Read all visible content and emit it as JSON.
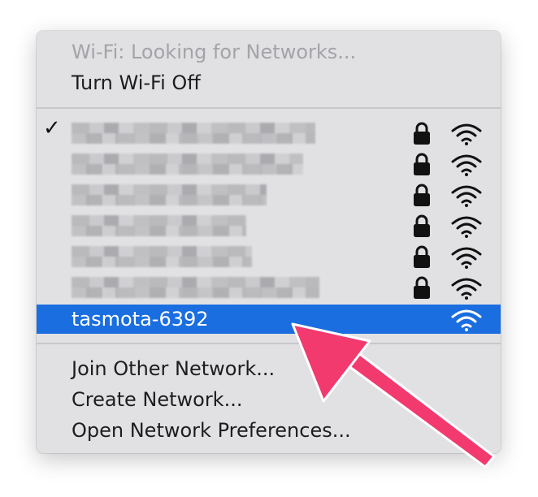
{
  "menu": {
    "status": "Wi-Fi: Looking for Networks...",
    "turn_off": "Turn Wi-Fi Off",
    "networks": [
      {
        "name": "",
        "connected": true,
        "secured": true,
        "icon": "wifi-icon"
      },
      {
        "name": "",
        "connected": false,
        "secured": true,
        "icon": "wifi-icon"
      },
      {
        "name": "",
        "connected": false,
        "secured": true,
        "icon": "wifi-icon"
      },
      {
        "name": "",
        "connected": false,
        "secured": true,
        "icon": "wifi-icon"
      },
      {
        "name": "",
        "connected": false,
        "secured": true,
        "icon": "wifi-icon"
      },
      {
        "name": "",
        "connected": false,
        "secured": true,
        "icon": "wifi-icon"
      }
    ],
    "check_mark": "✓",
    "selected_network": "tasmota-6392",
    "join_other": "Join Other Network...",
    "create_network": "Create Network...",
    "open_prefs": "Open Network Preferences..."
  },
  "colors": {
    "menu_bg": "#e1e1e3",
    "highlight": "#1a6ee0",
    "arrow": "#f23a6f",
    "disabled_text": "#a3a3a8"
  },
  "annotation": {
    "icon": "pointer-arrow"
  }
}
